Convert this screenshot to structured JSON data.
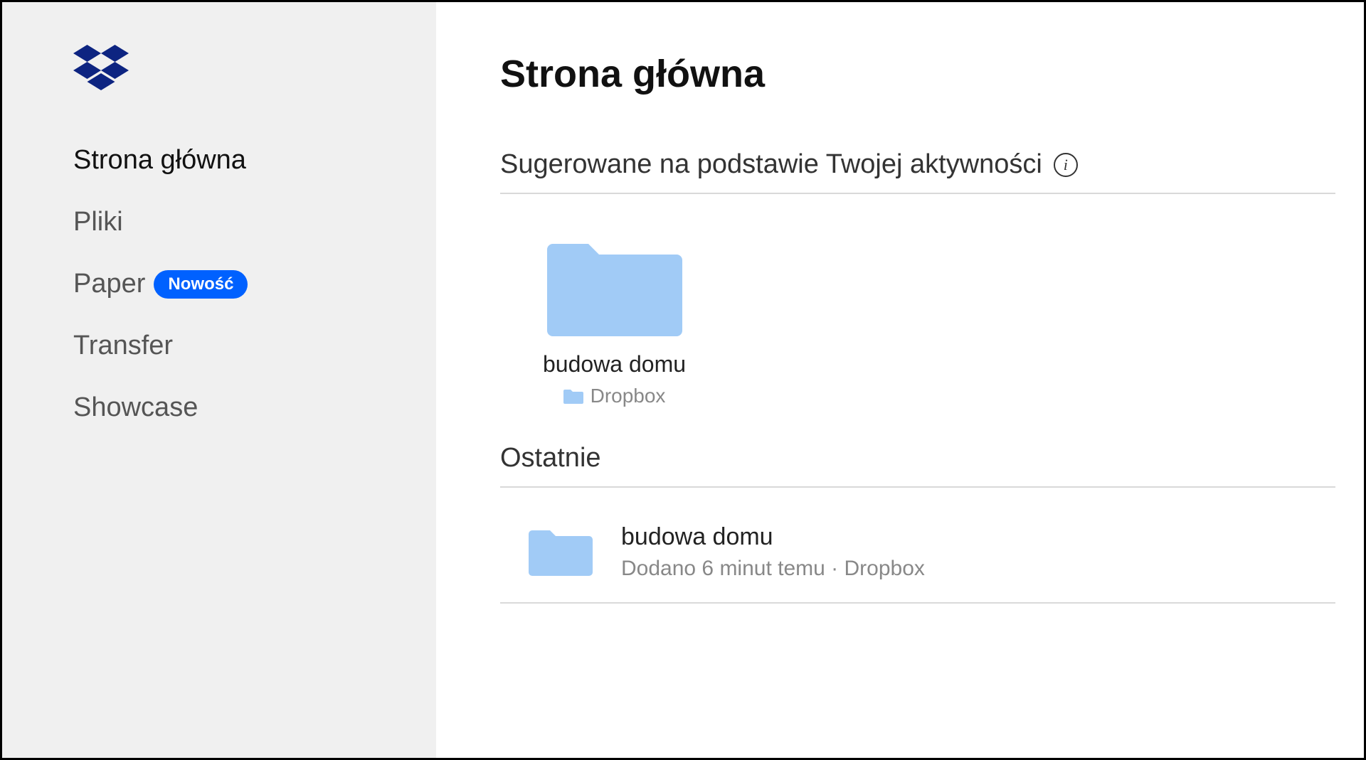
{
  "sidebar": {
    "nav": [
      {
        "label": "Strona główna",
        "active": true
      },
      {
        "label": "Pliki"
      },
      {
        "label": "Paper",
        "badge": "Nowość"
      },
      {
        "label": "Transfer"
      },
      {
        "label": "Showcase"
      }
    ]
  },
  "main": {
    "title": "Strona główna",
    "suggested": {
      "heading": "Sugerowane na podstawie Twojej aktywności",
      "items": [
        {
          "name": "budowa domu",
          "location": "Dropbox"
        }
      ]
    },
    "recent": {
      "heading": "Ostatnie",
      "items": [
        {
          "name": "budowa domu",
          "meta": "Dodano 6 minut temu · Dropbox"
        }
      ]
    }
  },
  "colors": {
    "brand": "#0061ff",
    "folder": "#a1cbf6"
  }
}
